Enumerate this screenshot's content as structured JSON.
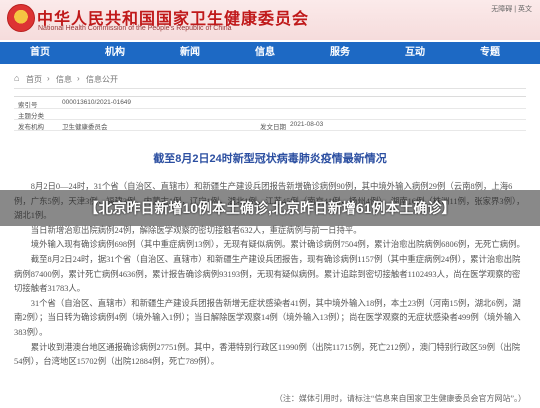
{
  "header": {
    "title_cn": "中华人民共和国国家卫生健康委员会",
    "title_en": "National Health Commission of the People's Republic of China",
    "links": "无障碍 | 英文"
  },
  "nav": [
    "首页",
    "机构",
    "新闻",
    "信息",
    "服务",
    "互动",
    "专题"
  ],
  "breadcrumb": [
    "首页",
    "信息",
    "信息公开"
  ],
  "meta": {
    "index_label": "索引号",
    "index_value": "000013610/2021-01649",
    "topic_label": "主题分类",
    "topic_value": "",
    "dept_label": "发布机构",
    "dept_value": "卫生健康委员会",
    "date_label": "发文日期",
    "date_value": "2021-08-03"
  },
  "article": {
    "title": "截至8月2日24时新型冠状病毒肺炎疫情最新情况",
    "paragraphs": [
      "8月2日0—24时，31个省（自治区、直辖市）和新疆生产建设兵团报告新增确诊病例90例，其中境外输入病例29例（云南8例，上海6例，广东5例，天津3例，福建3例，内蒙古1例，辽宁1例，湖北1例，江苏45例（南京41例，扬州4例），湖南16例（株洲11例，张家界3例），湖北1例。",
      "当日新增治愈出院病例24例，解除医学观察的密切接触者632人，重症病例与前一日持平。",
      "境外输入现有确诊病例698例（其中重症病例13例），无现有疑似病例。累计确诊病例7504例，累计治愈出院病例6806例，无死亡病例。",
      "截至8月2日24时，据31个省（自治区、直辖市）和新疆生产建设兵团报告，现有确诊病例1157例（其中重症病例24例），累计治愈出院病例87400例，累计死亡病例4636例，累计报告确诊病例93193例，无现有疑似病例。累计追踪到密切接触者1102493人，尚在医学观察的密切接触者31783人。",
      "31个省（自治区、直辖市）和新疆生产建设兵团报告新增无症状感染者41例，其中境外输入18例，本土23例（河南15例，湖北6例，湖南2例）；当日转为确诊病例4例（境外输入1例）；当日解除医学观察14例（境外输入13例）；尚在医学观察的无症状感染者499例（境外输入383例）。",
      "累计收到港澳台地区通报确诊病例27751例。其中，香港特别行政区11990例（出院11715例，死亡212例），澳门特别行政区59例（出院54例），台湾地区15702例（出院12884例，死亡789例）。"
    ],
    "note": "（注：媒体引用时，请标注“信息来自国家卫生健康委员会官方网站”。）"
  },
  "overlay": {
    "headline": "【北京昨日新增10例本土确诊,北京昨日新增61例本土确诊】"
  }
}
